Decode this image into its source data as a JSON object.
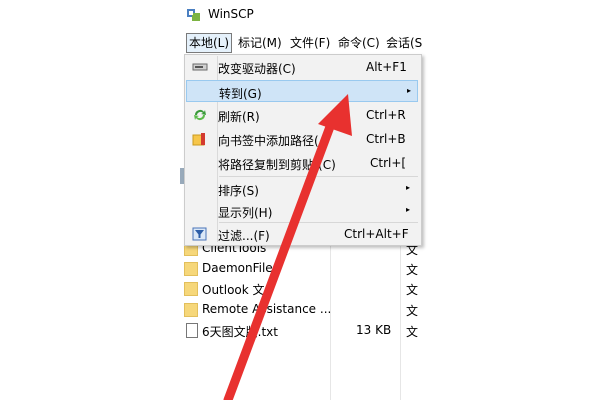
{
  "window": {
    "title": "WinSCP"
  },
  "menubar": {
    "items": [
      {
        "label": "本地(L)"
      },
      {
        "label": "标记(M)"
      },
      {
        "label": "文件(F)"
      },
      {
        "label": "命令(C)"
      },
      {
        "label": "会话(S"
      }
    ]
  },
  "menu": {
    "items": [
      {
        "label": "改变驱动器(C)",
        "shortcut": "Alt+F1",
        "icon": "drive-icon"
      },
      {
        "label": "转到(G)",
        "submenu": "▸",
        "highlighted": true
      },
      {
        "label": "刷新(R)",
        "shortcut": "Ctrl+R",
        "icon": "refresh-icon"
      },
      {
        "label": "向书签中添加路径(A",
        "shortcut": "Ctrl+B",
        "icon": "bookmark-icon"
      },
      {
        "label": "将路径复制到剪贴",
        "suffix": "(C)",
        "shortcut": "Ctrl+[",
        "icon": ""
      },
      {
        "label": "排序(S)",
        "submenu": "▸"
      },
      {
        "label": "显示列(H)",
        "submenu": "▸"
      },
      {
        "label": "过滤...(F)",
        "shortcut": "Ctrl+Alt+F",
        "icon": "filter-icon"
      }
    ]
  },
  "files": [
    {
      "name": "ClientTools",
      "size": "",
      "type": "文"
    },
    {
      "name": "DaemonFiles",
      "size": "",
      "type": "文"
    },
    {
      "name": "Outlook 文",
      "size": "",
      "type": "文"
    },
    {
      "name": "Remote Assistance ...",
      "size": "",
      "type": "文"
    },
    {
      "name": "6天图文版.txt",
      "size": "13 KB",
      "type": "文"
    }
  ],
  "colors": {
    "highlight": "#cfe4f7",
    "arrow": "#e8312f",
    "menu_bg": "#f2f2f2"
  }
}
